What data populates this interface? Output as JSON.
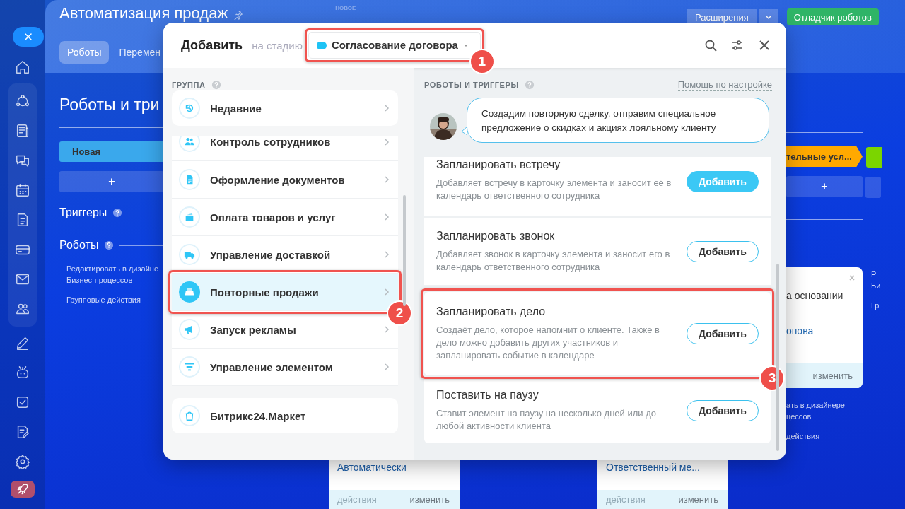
{
  "page": {
    "title": "Автоматизация продаж",
    "new_tag": "НОВОЕ",
    "extensions_button": "Расширения",
    "debugger_button": "Отладчик роботов",
    "tabs": [
      {
        "label": "Роботы",
        "selected": true
      },
      {
        "label": "Перемен",
        "selected": false
      }
    ],
    "section_title": "Роботы и три",
    "left_column": {
      "stage": {
        "label": "Новая",
        "color": "#3aa8ec"
      },
      "add": "+",
      "triggers_label": "Триггеры",
      "robots_label": "Роботы",
      "links": [
        "Редактировать в дизайне\nБизнес-процессов",
        "Групповые действия"
      ]
    },
    "right_column": {
      "stage": {
        "label": "тельные усл...",
        "color": "#ffa900"
      },
      "add": "+",
      "robot_card": {
        "text": "а основании",
        "link": "опова",
        "footer": "изменить"
      },
      "links": [
        "ать в дизайнере\nцессов",
        "действия"
      ]
    },
    "far_column": {
      "stage": {
        "color": "#7bd500"
      },
      "links": [
        "Р\nБи",
        "Гр"
      ]
    },
    "bottom_cards": [
      {
        "text": "Автоматически",
        "footer_left": "действия",
        "footer_right": "изменить"
      },
      {
        "text": "Ответственный ме...",
        "footer_left": "действия",
        "footer_right": "изменить"
      }
    ]
  },
  "modal": {
    "title": "Добавить",
    "stage_prefix": "на стадию",
    "stage": {
      "label": "Согласование договора",
      "color": "#1ec3f5",
      "callout": "1"
    },
    "group_heading": "ГРУППА",
    "recent": {
      "label": "Недавние",
      "selected": false
    },
    "groups": [
      {
        "label": "Контроль сотрудников",
        "selected": false
      },
      {
        "label": "Оформление документов",
        "selected": false
      },
      {
        "label": "Оплата товаров и услуг",
        "selected": false
      },
      {
        "label": "Управление доставкой",
        "selected": false
      },
      {
        "label": "Повторные продажи",
        "selected": true,
        "callout": "2"
      },
      {
        "label": "Запуск рекламы",
        "selected": false
      },
      {
        "label": "Управление элементом",
        "selected": false
      }
    ],
    "market": "Битрикс24.Маркет",
    "robots_heading": "РОБОТЫ И ТРИГГЕРЫ",
    "help_link": "Помощь по настройке",
    "hint": "Создадим повторную сделку, отправим специальное предложение о скидках и акциях лояльному клиенту",
    "robots": [
      {
        "title": "Запланировать встречу",
        "description": "Добавляет встречу в карточку элемента и заносит её в календарь ответственного сотрудника",
        "button": "Добавить",
        "highlighted": true
      },
      {
        "title": "Запланировать звонок",
        "description": "Добавляет звонок в карточку элемента и заносит его в календарь ответственного сотрудника",
        "button": "Добавить",
        "highlighted": false
      },
      {
        "title": "Запланировать дело",
        "description": "Создаёт дело, которое напомнит о клиенте. Также в дело можно добавить других участников и запланировать событие в календаре",
        "button": "Добавить",
        "highlighted": false,
        "callout": "3"
      },
      {
        "title": "Поставить на паузу",
        "description": "Ставит элемент на паузу на несколько дней или до любой активности клиента",
        "button": "Добавить",
        "highlighted": false
      }
    ]
  }
}
